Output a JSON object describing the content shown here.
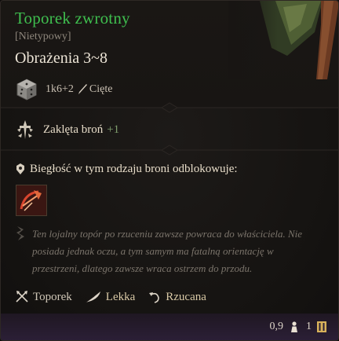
{
  "item": {
    "name": "Toporek zwrotny",
    "rarity": "[Nietypowy]",
    "damage_title": "Obrażenia 3~8",
    "damage_dice": "1k6+2",
    "damage_type": "Cięte"
  },
  "enchantment": {
    "label": "Zaklęta broń",
    "bonus": "+1"
  },
  "proficiency": {
    "label": "Biegłość w tym rodzaju broni odblokowuje:"
  },
  "flavor_text": "Ten lojalny topór po rzuceniu zawsze powraca do właściciela. Nie posiada jednak oczu, a tym samym ma fatalną orientację w przestrzeni, dlatego zawsze wraca ostrzem do przodu.",
  "properties": [
    {
      "label": "Toporek",
      "icon": "crossed-axes-icon"
    },
    {
      "label": "Lekka",
      "icon": "feather-icon"
    },
    {
      "label": "Rzucana",
      "icon": "throw-icon"
    }
  ],
  "footer": {
    "weight": "0,9",
    "value": "1",
    "weight_icon": "weight-icon",
    "value_icon": "gold-coin-icon"
  },
  "colors": {
    "name_uncommon": "#3fbf4f",
    "enchant_bonus": "#7f9e6e",
    "footer_bg": "#2b1f36"
  }
}
